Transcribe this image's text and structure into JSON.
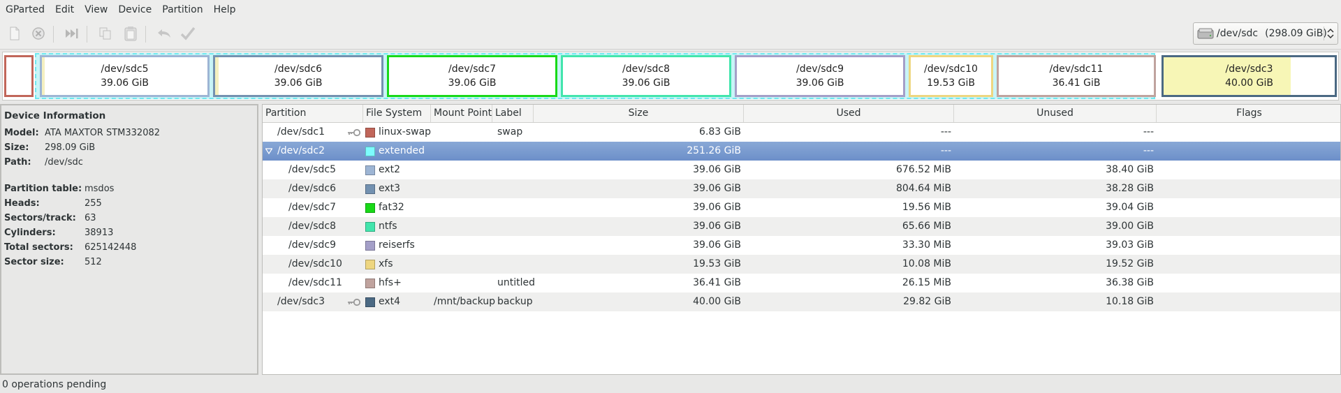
{
  "menubar": [
    "GParted",
    "Edit",
    "View",
    "Device",
    "Partition",
    "Help"
  ],
  "toolbar": {
    "buttons": [
      "new-icon",
      "delete-icon",
      "resize-move-icon",
      "copy-icon",
      "paste-icon",
      "undo-icon",
      "apply-icon"
    ]
  },
  "device_selector": {
    "device": "/dev/sdc",
    "size": "(298.09 GiB)"
  },
  "partition_map": {
    "sdc1_label": "",
    "boxes": [
      {
        "name": "/dev/sdc5",
        "size": "39.06 GiB",
        "color": "#9db5d4"
      },
      {
        "name": "/dev/sdc6",
        "size": "39.06 GiB",
        "color": "#7391b0"
      },
      {
        "name": "/dev/sdc7",
        "size": "39.06 GiB",
        "color": "#18d918"
      },
      {
        "name": "/dev/sdc8",
        "size": "39.06 GiB",
        "color": "#42e5ac"
      },
      {
        "name": "/dev/sdc9",
        "size": "39.06 GiB",
        "color": "#a49fc8"
      },
      {
        "name": "/dev/sdc10",
        "size": "19.53 GiB",
        "color": "#eed680"
      },
      {
        "name": "/dev/sdc11",
        "size": "36.41 GiB",
        "color": "#c0a39e"
      },
      {
        "name": "/dev/sdc3",
        "size": "40.00 GiB",
        "color": "#4b6983"
      }
    ]
  },
  "device_info": {
    "title": "Device Information",
    "model_label": "Model:",
    "model": "ATA MAXTOR STM332082",
    "size_label": "Size:",
    "size": "298.09 GiB",
    "path_label": "Path:",
    "path": "/dev/sdc",
    "table_label": "Partition table:",
    "table": "msdos",
    "heads_label": "Heads:",
    "heads": "255",
    "sectors_label": "Sectors/track:",
    "sectors": "63",
    "cylinders_label": "Cylinders:",
    "cylinders": "38913",
    "total_label": "Total sectors:",
    "total": "625142448",
    "sector_size_label": "Sector size:",
    "sector_size": "512"
  },
  "columns": [
    "Partition",
    "File System",
    "Mount Point",
    "Label",
    "Size",
    "Used",
    "Unused",
    "Flags"
  ],
  "rows": [
    {
      "partition": "/dev/sdc1",
      "fs": "linux-swap",
      "mount": "",
      "label": "swap",
      "size": "6.83 GiB",
      "used": "---",
      "unused": "---",
      "flags": "",
      "color": "#c1665a"
    },
    {
      "partition": "/dev/sdc2",
      "fs": "extended",
      "mount": "",
      "label": "",
      "size": "251.26 GiB",
      "used": "---",
      "unused": "---",
      "flags": "",
      "color": "#7dfcfe"
    },
    {
      "partition": "/dev/sdc5",
      "fs": "ext2",
      "mount": "",
      "label": "",
      "size": "39.06 GiB",
      "used": "676.52 MiB",
      "unused": "38.40 GiB",
      "flags": "",
      "color": "#9db5d4"
    },
    {
      "partition": "/dev/sdc6",
      "fs": "ext3",
      "mount": "",
      "label": "",
      "size": "39.06 GiB",
      "used": "804.64 MiB",
      "unused": "38.28 GiB",
      "flags": "",
      "color": "#7391b0"
    },
    {
      "partition": "/dev/sdc7",
      "fs": "fat32",
      "mount": "",
      "label": "",
      "size": "39.06 GiB",
      "used": "19.56 MiB",
      "unused": "39.04 GiB",
      "flags": "",
      "color": "#18d918"
    },
    {
      "partition": "/dev/sdc8",
      "fs": "ntfs",
      "mount": "",
      "label": "",
      "size": "39.06 GiB",
      "used": "65.66 MiB",
      "unused": "39.00 GiB",
      "flags": "",
      "color": "#42e5ac"
    },
    {
      "partition": "/dev/sdc9",
      "fs": "reiserfs",
      "mount": "",
      "label": "",
      "size": "39.06 GiB",
      "used": "33.30 MiB",
      "unused": "39.03 GiB",
      "flags": "",
      "color": "#a49fc8"
    },
    {
      "partition": "/dev/sdc10",
      "fs": "xfs",
      "mount": "",
      "label": "",
      "size": "19.53 GiB",
      "used": "10.08 MiB",
      "unused": "19.52 GiB",
      "flags": "",
      "color": "#eed680"
    },
    {
      "partition": "/dev/sdc11",
      "fs": "hfs+",
      "mount": "",
      "label": "untitled",
      "size": "36.41 GiB",
      "used": "26.15 MiB",
      "unused": "36.38 GiB",
      "flags": "",
      "color": "#c0a39e"
    },
    {
      "partition": "/dev/sdc3",
      "fs": "ext4",
      "mount": "/mnt/backup",
      "label": "backup",
      "size": "40.00 GiB",
      "used": "29.82 GiB",
      "unused": "10.18 GiB",
      "flags": "",
      "color": "#4b6983"
    }
  ],
  "status": "0 operations pending"
}
